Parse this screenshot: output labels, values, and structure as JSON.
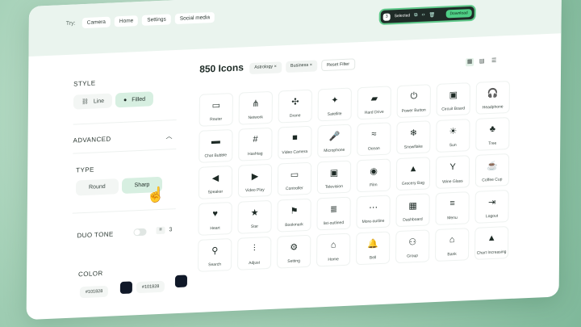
{
  "topbar": {
    "try_label": "Try:",
    "chips": [
      "Camera",
      "Home",
      "Settings",
      "Social media"
    ]
  },
  "selection": {
    "count": "3",
    "label": "Selected",
    "download_label": "Download"
  },
  "sidebar": {
    "style_title": "STYLE",
    "style_options": [
      {
        "label": "Line",
        "selected": false,
        "icon": "link-icon"
      },
      {
        "label": "Filled",
        "selected": true,
        "icon": "filled-link-icon"
      }
    ],
    "advanced_title": "ADVANCED",
    "type_title": "TYPE",
    "type_options": [
      {
        "label": "Round",
        "selected": false
      },
      {
        "label": "Sharp",
        "selected": true
      }
    ],
    "duotone_title": "DUO TONE",
    "duotone_value": "3",
    "color_title": "COLOR",
    "color_values": [
      "#101828",
      "#101828"
    ],
    "swatch_color": "#101828"
  },
  "main": {
    "title": "850 Icons",
    "filters": [
      "Astrology",
      "Business"
    ],
    "reset_label": "Reset Filter",
    "icons": [
      [
        "Router",
        "Network",
        "Drone",
        "Satellite",
        "Hard Drive",
        "Power Button",
        "Circuit Board",
        "Headphone"
      ],
      [
        "Chat Bubble",
        "Hashtag",
        "Video Camera",
        "Microphone",
        "Ocean",
        "Snowflake",
        "Sun",
        "Tree"
      ],
      [
        "Speaker",
        "Video Play",
        "Controller",
        "Television",
        "Film",
        "Grocery Bag",
        "Wine Glass",
        "Coffee Cup"
      ],
      [
        "Heart",
        "Star",
        "Bookmark",
        "list-outlined",
        "More-outline",
        "Dashboard",
        "Menu",
        "Logout"
      ],
      [
        "Search",
        "Adjust",
        "Setting",
        "Home",
        "Bell",
        "Group",
        "Bank",
        "Chart Increasing"
      ]
    ]
  },
  "colors": {
    "accent": "#4fcf86",
    "selected_bg": "#d7efe1",
    "topbar_bg": "#eaf4ee"
  }
}
